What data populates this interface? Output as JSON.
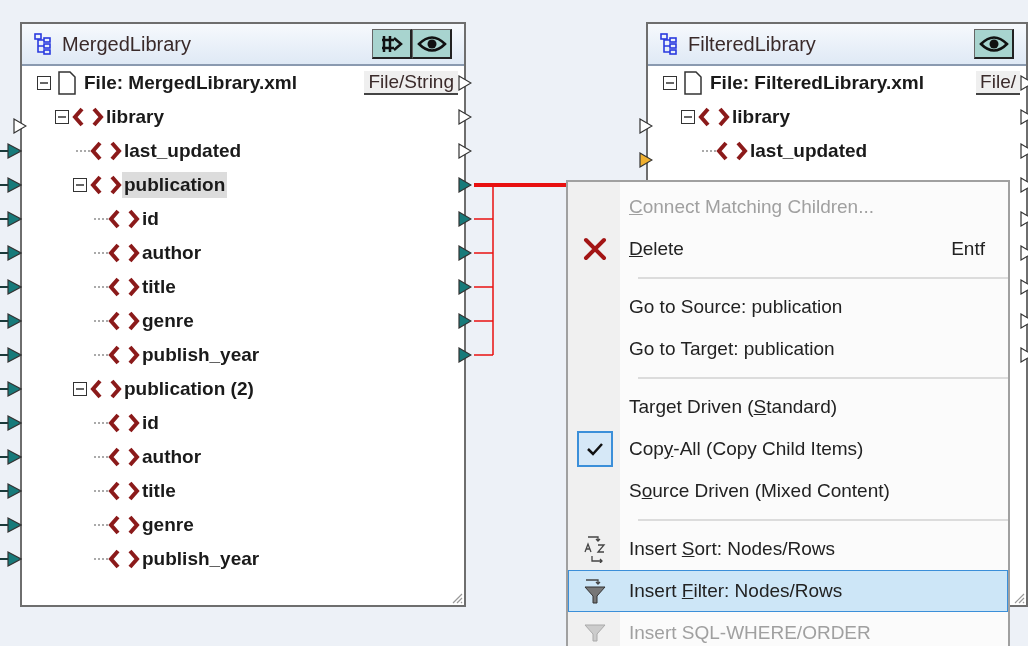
{
  "components": [
    {
      "title": "MergedLibrary",
      "header_buttons": [
        {
          "kind": "stream",
          "on": true
        },
        {
          "kind": "preview",
          "on": true
        }
      ],
      "tree": [
        {
          "kind": "file",
          "label": "File: MergedLibrary.xml",
          "button": "File/String",
          "expanded": true,
          "highlighted": false,
          "out_port": {
            "kind": "empty"
          },
          "children": [
            {
              "kind": "element",
              "label": "library",
              "expanded": true,
              "highlighted": false,
              "in_port": {
                "kind": "empty"
              },
              "out_port": {
                "kind": "empty"
              },
              "children": [
                {
                  "kind": "element",
                  "label": "last_updated",
                  "highlighted": false,
                  "in_port": {
                    "kind": "filled"
                  },
                  "out_port": {
                    "kind": "empty"
                  }
                },
                {
                  "kind": "element",
                  "label": "publication",
                  "expanded": true,
                  "highlighted": true,
                  "in_port": {
                    "kind": "filled"
                  },
                  "out_port": {
                    "kind": "filled"
                  },
                  "children": [
                    {
                      "kind": "element",
                      "label": "id",
                      "highlighted": false,
                      "in_port": {
                        "kind": "filled"
                      },
                      "out_port": {
                        "kind": "filled"
                      }
                    },
                    {
                      "kind": "element",
                      "label": "author",
                      "highlighted": false,
                      "in_port": {
                        "kind": "filled"
                      },
                      "out_port": {
                        "kind": "filled"
                      }
                    },
                    {
                      "kind": "element",
                      "label": "title",
                      "highlighted": false,
                      "in_port": {
                        "kind": "filled"
                      },
                      "out_port": {
                        "kind": "filled"
                      }
                    },
                    {
                      "kind": "element",
                      "label": "genre",
                      "highlighted": false,
                      "in_port": {
                        "kind": "filled"
                      },
                      "out_port": {
                        "kind": "filled"
                      }
                    },
                    {
                      "kind": "element",
                      "label": "publish_year",
                      "highlighted": false,
                      "in_port": {
                        "kind": "filled"
                      },
                      "out_port": {
                        "kind": "filled"
                      }
                    }
                  ]
                },
                {
                  "kind": "element",
                  "label": "publication (2)",
                  "expanded": true,
                  "highlighted": false,
                  "in_port": {
                    "kind": "filled"
                  },
                  "children": [
                    {
                      "kind": "element",
                      "label": "id",
                      "highlighted": false,
                      "in_port": {
                        "kind": "filled"
                      }
                    },
                    {
                      "kind": "element",
                      "label": "author",
                      "highlighted": false,
                      "in_port": {
                        "kind": "filled"
                      }
                    },
                    {
                      "kind": "element",
                      "label": "title",
                      "highlighted": false,
                      "in_port": {
                        "kind": "filled"
                      }
                    },
                    {
                      "kind": "element",
                      "label": "genre",
                      "highlighted": false,
                      "in_port": {
                        "kind": "filled"
                      }
                    },
                    {
                      "kind": "element",
                      "label": "publish_year",
                      "highlighted": false,
                      "in_port": {
                        "kind": "filled"
                      }
                    }
                  ]
                }
              ]
            }
          ]
        }
      ]
    },
    {
      "title": "FilteredLibrary",
      "header_buttons": [
        {
          "kind": "preview",
          "on": true
        }
      ],
      "tree": [
        {
          "kind": "file",
          "label": "File: FilteredLibrary.xml",
          "button": "File/",
          "expanded": true,
          "highlighted": false,
          "out_port": {
            "kind": "empty"
          },
          "children": [
            {
              "kind": "element",
              "label": "library",
              "expanded": true,
              "highlighted": false,
              "in_port": {
                "kind": "empty"
              },
              "out_port": {
                "kind": "empty"
              },
              "children": [
                {
                  "kind": "element",
                  "label": "last_updated",
                  "highlighted": false,
                  "in_port": {
                    "kind": "pending"
                  },
                  "out_port": {
                    "kind": "empty"
                  }
                }
              ]
            }
          ]
        }
      ],
      "covered_rows": [
        {
          "out_port": {
            "kind": "empty"
          }
        },
        {
          "out_port": {
            "kind": "empty"
          }
        },
        {
          "out_port": {
            "kind": "empty"
          }
        },
        {
          "out_port": {
            "kind": "empty"
          }
        },
        {
          "out_port": {
            "kind": "empty"
          }
        },
        {
          "out_port": {
            "kind": "empty"
          }
        }
      ]
    }
  ],
  "context_menu": {
    "items": [
      {
        "kind": "command",
        "key": "C",
        "after": "onnect Matching Children...",
        "disabled": true,
        "checked": false,
        "selected": false
      },
      {
        "kind": "delete",
        "key": "D",
        "after": "elete",
        "shortcut": "Entf",
        "disabled": false,
        "checked": false,
        "selected": false
      },
      {
        "kind": "separator"
      },
      {
        "kind": "command",
        "before": "Go to Source: publication",
        "disabled": false,
        "checked": false,
        "selected": false
      },
      {
        "kind": "command",
        "before": "Go to Target: publication",
        "disabled": false,
        "checked": false,
        "selected": false
      },
      {
        "kind": "separator"
      },
      {
        "kind": "command",
        "before": "Target Driven (",
        "key": "S",
        "after": "tandard)",
        "disabled": false,
        "checked": false,
        "selected": false
      },
      {
        "kind": "command",
        "before": "Cop",
        "key": "y",
        "after": "-All (Copy Child Items)",
        "disabled": false,
        "checked": true,
        "selected": false
      },
      {
        "kind": "command",
        "before": "S",
        "key": "o",
        "after": "urce Driven (Mixed Content)",
        "disabled": false,
        "checked": false,
        "selected": false
      },
      {
        "kind": "separator"
      },
      {
        "kind": "sort",
        "before": "Insert ",
        "key": "S",
        "after": "ort: Nodes/Rows",
        "disabled": false,
        "checked": false,
        "selected": false
      },
      {
        "kind": "filter",
        "before": "Insert ",
        "key": "F",
        "after": "ilter: Nodes/Rows",
        "disabled": false,
        "checked": false,
        "selected": true
      },
      {
        "kind": "sql",
        "before": "Insert SQL-WHERE/ORDER",
        "disabled": true,
        "checked": false,
        "selected": false
      }
    ]
  }
}
